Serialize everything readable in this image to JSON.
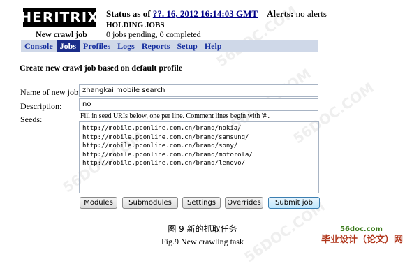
{
  "logo": {
    "text": "HERITRIX"
  },
  "header": {
    "crawl_label": "New crawl job",
    "status_prefix": "Status as of ",
    "status_time": "??. 16, 2012 16:14:03 GMT",
    "alerts_label": "Alerts:",
    "alerts_value": " no alerts",
    "holding": "HOLDING JOBS",
    "pending": "0 jobs pending, 0 completed"
  },
  "nav": {
    "items": [
      {
        "label": "Console"
      },
      {
        "label": "Jobs"
      },
      {
        "label": "Profiles"
      },
      {
        "label": "Logs"
      },
      {
        "label": "Reports"
      },
      {
        "label": "Setup"
      },
      {
        "label": "Help"
      }
    ]
  },
  "form": {
    "heading": "Create new crawl job based on default profile",
    "name_label": "Name of new job:",
    "name_value": "zhangkai mobile search",
    "desc_label": "Description:",
    "desc_value": "no",
    "seeds_label": "Seeds:",
    "seeds_hint": "Fill in seed URIs below, one per line. Comment lines begin with '#'.",
    "seeds_value": "http://mobile.pconline.com.cn/brand/nokia/\nhttp://mobile.pconline.com.cn/brand/samsung/\nhttp://mobile.pconline.com.cn/brand/sony/\nhttp://mobile.pconline.com.cn/brand/motorola/\nhttp://mobile.pconline.com.cn/brand/lenovo/"
  },
  "buttons": {
    "modules": "Modules",
    "submodules": "Submodules",
    "settings": "Settings",
    "overrides": "Overrides",
    "submit": "Submit job"
  },
  "caption": {
    "cn": "图 9    新的抓取任务",
    "en": "Fig.9 New crawling task"
  },
  "watermark": {
    "text": "56DOC.COM",
    "site": "56doc.com",
    "brand": "毕业设计（论文）网"
  }
}
